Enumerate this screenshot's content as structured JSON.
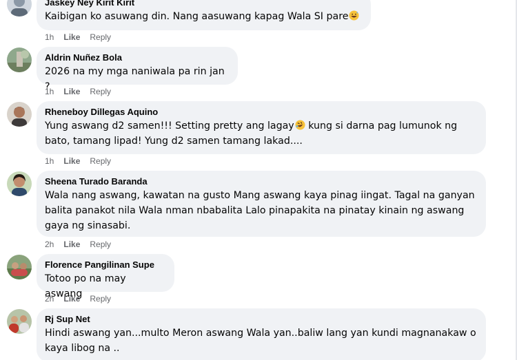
{
  "comments": [
    {
      "author": "Jaskey Ney Kirit Kirit",
      "text": "Kaibigan ko asuwang din. Nang aasuwang kapag Wala SI pare",
      "emoji": "grinning-sweat-emoji",
      "time": "1h",
      "like": "Like",
      "reply": "Reply"
    },
    {
      "author": "Aldrin Nuñez Bola",
      "text": "2026 na my mga naniwala pa rin jan ?",
      "time": "1h",
      "like": "Like",
      "reply": "Reply"
    },
    {
      "author": "Rheneboy Dillegas Aquino",
      "text_a": "Yung aswang d2 samen!!! Setting pretty ang lagay",
      "emoji": "rofl-emoji",
      "text_b": " kung si darna pag lumunok ng bato, tamang lipad! Yung d2 samen tamang lakad....",
      "time": "1h",
      "like": "Like",
      "reply": "Reply"
    },
    {
      "author": "Sheena Turado Baranda",
      "text": "Wala nang aswang, kawatan na gusto Mang aswang kaya pinag iingat. Tagal na ganyan balita panakot nila Wala nman nbabalita Lalo pinapakita na pinatay kinain ng aswang gaya ng sinasabi.",
      "time": "2h",
      "like": "Like",
      "reply": "Reply"
    },
    {
      "author": "Florence Pangilinan Supe",
      "text": "Totoo po na may aswang",
      "time": "2h",
      "like": "Like",
      "reply": "Reply"
    },
    {
      "author": "Rj Sup Net",
      "text": "Hindi aswang yan...multo Meron aswang Wala yan..baliw lang yan kundi magnanakaw o kaya libog na ..",
      "time": "",
      "like": "",
      "reply": ""
    }
  ],
  "colors": {
    "bubble": "#f0f2f5",
    "meta": "#65676b",
    "text": "#050505"
  }
}
